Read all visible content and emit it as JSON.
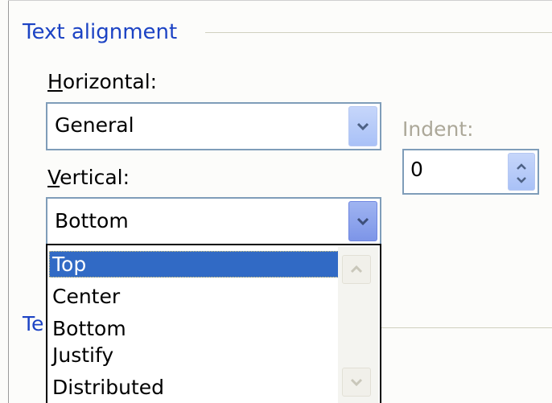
{
  "group": {
    "title": "Text alignment"
  },
  "horizontal": {
    "label_prefix": "",
    "label_accel": "H",
    "label_rest": "orizontal:",
    "value": "General"
  },
  "indent": {
    "label": "Indent:",
    "value": "0"
  },
  "vertical": {
    "label_accel": "V",
    "label_rest": "ertical:",
    "value": "Bottom"
  },
  "partial_label": "Te",
  "dropdown": {
    "items": [
      "Top",
      "Center",
      "Bottom",
      "Justify",
      "Distributed"
    ],
    "selected_index": 0
  },
  "colors": {
    "accent": "#1c43c4",
    "selection": "#316ac5",
    "border": "#7f9db9"
  }
}
